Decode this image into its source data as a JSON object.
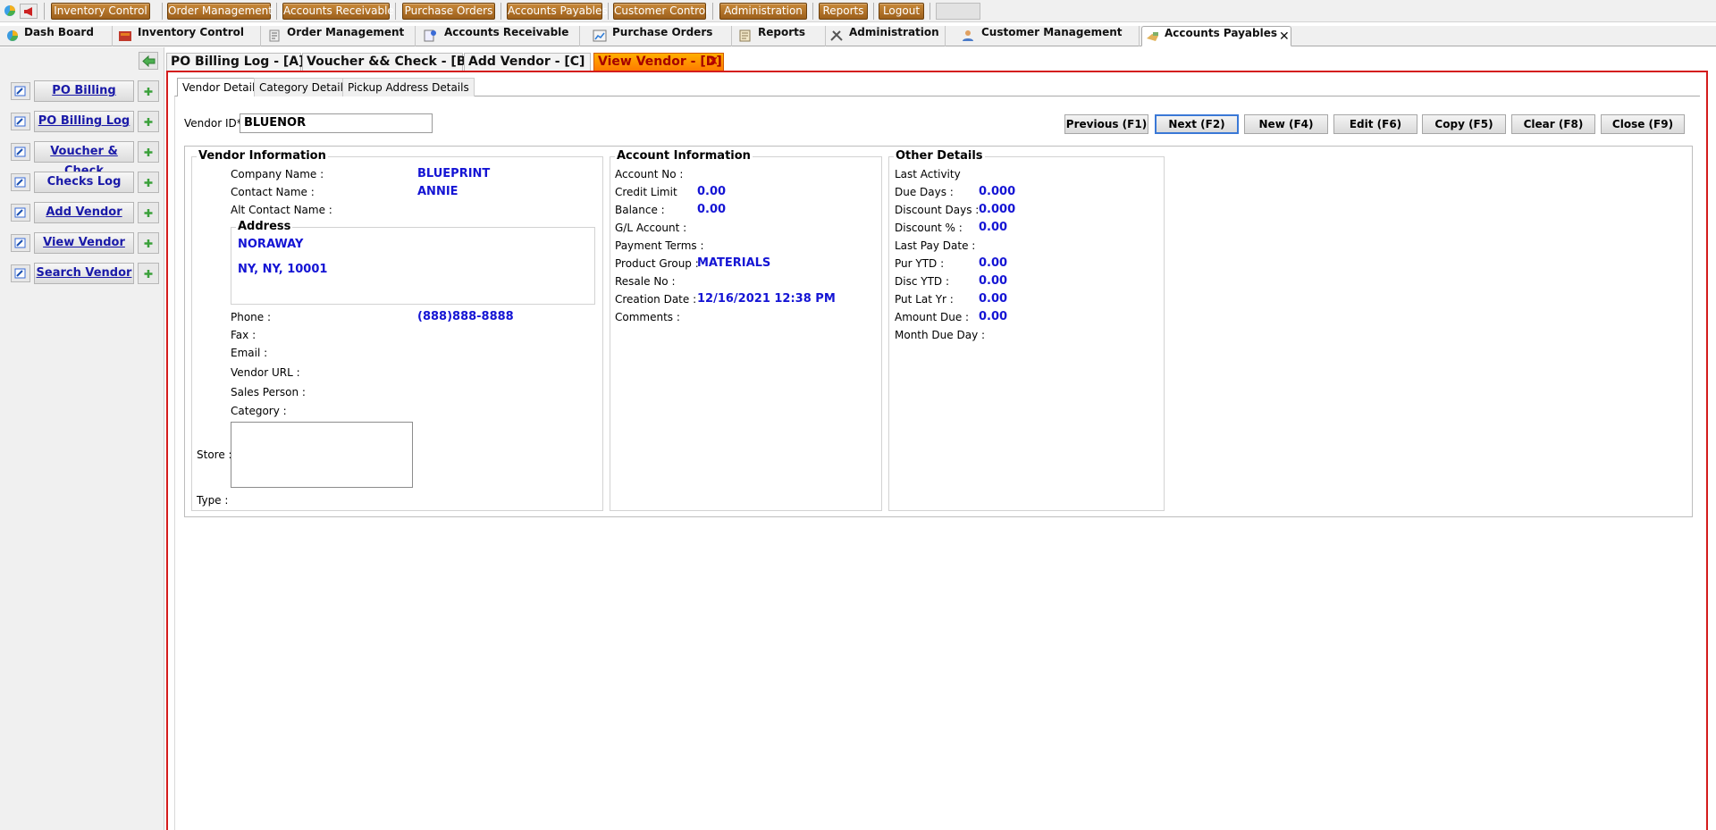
{
  "menubar": {
    "items": [
      "Inventory Control",
      "Order Management",
      "Accounts Receivable",
      "Purchase Orders",
      "Accounts Payables",
      "Customer Control",
      "Administration",
      "Reports",
      "Logout"
    ]
  },
  "module_tabs": [
    "Dash Board",
    "Inventory Control",
    "Order Management",
    "Accounts Receivable",
    "Purchase Orders",
    "Reports",
    "Administration",
    "Customer Management",
    "Accounts Payables"
  ],
  "sidebar": {
    "items": [
      "PO Billing",
      "PO Billing Log",
      "Voucher & Check",
      "Checks Log",
      "Add Vendor",
      "View Vendor",
      "Search Vendor"
    ]
  },
  "inner_tabs": [
    "PO Billing Log - [A]",
    "Voucher && Check - [B]",
    "Add Vendor - [C]",
    "View Vendor - [D]"
  ],
  "sub_tabs": [
    "Vendor Details",
    "Category Details",
    "Pickup Address Details"
  ],
  "vendor_id": {
    "label": "Vendor ID*",
    "value": "BLUENOR"
  },
  "actions": [
    "Previous (F1)",
    "Next (F2)",
    "New (F4)",
    "Edit (F6)",
    "Copy (F5)",
    "Clear (F8)",
    "Close (F9)"
  ],
  "vendor_info": {
    "title": "Vendor Information",
    "company_label": "Company Name :",
    "company": "BLUEPRINT",
    "contact_label": "Contact Name :",
    "contact": "ANNIE",
    "alt_contact_label": "Alt Contact Name :",
    "address_title": "Address",
    "address_line1": "NORAWAY",
    "address_line2": "NY, NY, 10001",
    "phone_label": "Phone :",
    "phone": "(888)888-8888",
    "fax_label": "Fax :",
    "email_label": "Email :",
    "url_label": "Vendor URL :",
    "sales_label": "Sales Person :",
    "category_label": "Category :",
    "store_label": "Store :",
    "type_label": "Type :"
  },
  "account_info": {
    "title": "Account Information",
    "account_no_label": "Account No :",
    "credit_limit_label": "Credit Limit",
    "credit_limit": "0.00",
    "balance_label": "Balance :",
    "balance": "0.00",
    "gl_label": "G/L Account :",
    "terms_label": "Payment Terms :",
    "product_group_label": "Product Group :",
    "product_group": "MATERIALS",
    "resale_label": "Resale No :",
    "creation_label": "Creation Date :",
    "creation": "12/16/2021 12:38 PM",
    "comments_label": "Comments :"
  },
  "other_details": {
    "title": "Other Details",
    "last_activity_label": "Last Activity",
    "due_days_label": "Due Days :",
    "due_days": "0.000",
    "discount_days_label": "Discount Days :",
    "discount_days": "0.000",
    "discount_pct_label": "Discount % :",
    "discount_pct": "0.00",
    "last_pay_label": "Last Pay Date :",
    "pur_ytd_label": "Pur YTD :",
    "pur_ytd": "0.00",
    "disc_ytd_label": "Disc YTD :",
    "disc_ytd": "0.00",
    "put_lat_label": "Put Lat Yr :",
    "put_lat": "0.00",
    "amount_due_label": "Amount Due :",
    "amount_due": "0.00",
    "month_due_label": "Month Due Day :"
  }
}
